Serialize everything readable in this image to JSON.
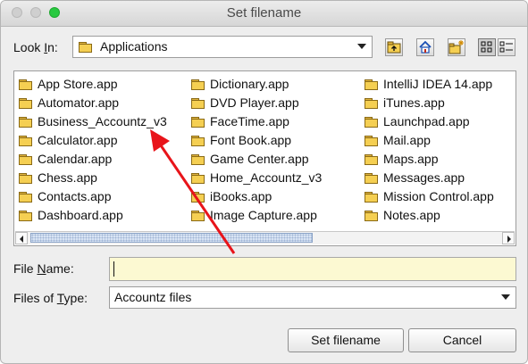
{
  "window": {
    "title": "Set filename"
  },
  "look_in": {
    "label_pre": "Look ",
    "label_key": "I",
    "label_post": "n:",
    "value": "Applications"
  },
  "toolbar": {
    "up_icon": "folder-up-icon",
    "home_icon": "home-icon",
    "new_folder_icon": "new-folder-icon",
    "list_view_icon": "list-view-icon",
    "details_view_icon": "details-view-icon"
  },
  "files": {
    "columns": [
      [
        "App Store.app",
        "Automator.app",
        "Business_Accountz_v3",
        "Calculator.app",
        "Calendar.app",
        "Chess.app",
        "Contacts.app",
        "Dashboard.app"
      ],
      [
        "Dictionary.app",
        "DVD Player.app",
        "FaceTime.app",
        "Font Book.app",
        "Game Center.app",
        "Home_Accountz_v3",
        "iBooks.app",
        "Image Capture.app"
      ],
      [
        "IntelliJ IDEA 14.app",
        "iTunes.app",
        "Launchpad.app",
        "Mail.app",
        "Maps.app",
        "Messages.app",
        "Mission Control.app",
        "Notes.app"
      ]
    ]
  },
  "file_name": {
    "label_pre": "File ",
    "label_key": "N",
    "label_post": "ame:",
    "value": ""
  },
  "file_type": {
    "label_pre": "Files of ",
    "label_key": "T",
    "label_post": "ype:",
    "value": "Accountz files"
  },
  "buttons": {
    "primary": "Set filename",
    "cancel": "Cancel"
  },
  "colors": {
    "annotation_arrow": "#e8141a",
    "input_bg": "#fcf9d2",
    "folder": "#f5cf52"
  }
}
